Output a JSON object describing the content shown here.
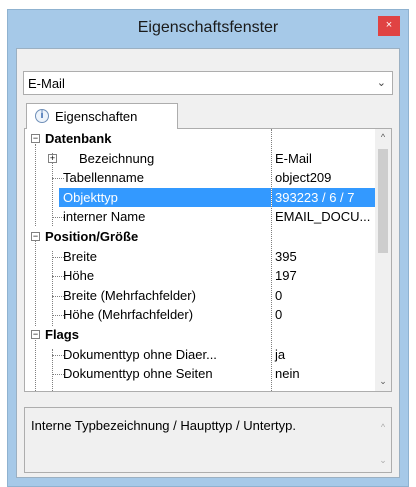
{
  "window": {
    "title": "Eigenschaftsfenster",
    "close_glyph": "×"
  },
  "selector": {
    "value": "E-Mail",
    "arrow": "⌄"
  },
  "tab": {
    "label": "Eigenschaften",
    "icon_glyph": "i"
  },
  "grid": {
    "categories": [
      {
        "name": "Datenbank"
      },
      {
        "name": "Position/Größe"
      },
      {
        "name": "Flags"
      }
    ],
    "rows": [
      {
        "key": "Bezeichnung",
        "value": "E-Mail"
      },
      {
        "key": "Tabellenname",
        "value": "object209"
      },
      {
        "key": "Objekttyp",
        "value": "393223 / 6 / 7"
      },
      {
        "key": "interner Name",
        "value": "EMAIL_DOCU..."
      },
      {
        "key": "Breite",
        "value": "395"
      },
      {
        "key": "Höhe",
        "value": "197"
      },
      {
        "key": "Breite (Mehrfachfelder)",
        "value": "0"
      },
      {
        "key": "Höhe (Mehrfachfelder)",
        "value": "0"
      },
      {
        "key": "Dokumenttyp ohne Diaer...",
        "value": "ja"
      },
      {
        "key": "Dokumenttyp ohne Seiten",
        "value": "nein"
      }
    ],
    "expand_glyph": "+",
    "collapse_glyph": "−",
    "scroll_up": "^",
    "scroll_down": "⌄"
  },
  "description": {
    "text": "Interne Typbezeichnung / Haupttyp / Untertyp.",
    "scroll_up": "^",
    "scroll_down": "⌄"
  },
  "colors": {
    "selection": "#3399ff",
    "window_frame": "#a6c9e8",
    "close_button": "#e04343"
  }
}
